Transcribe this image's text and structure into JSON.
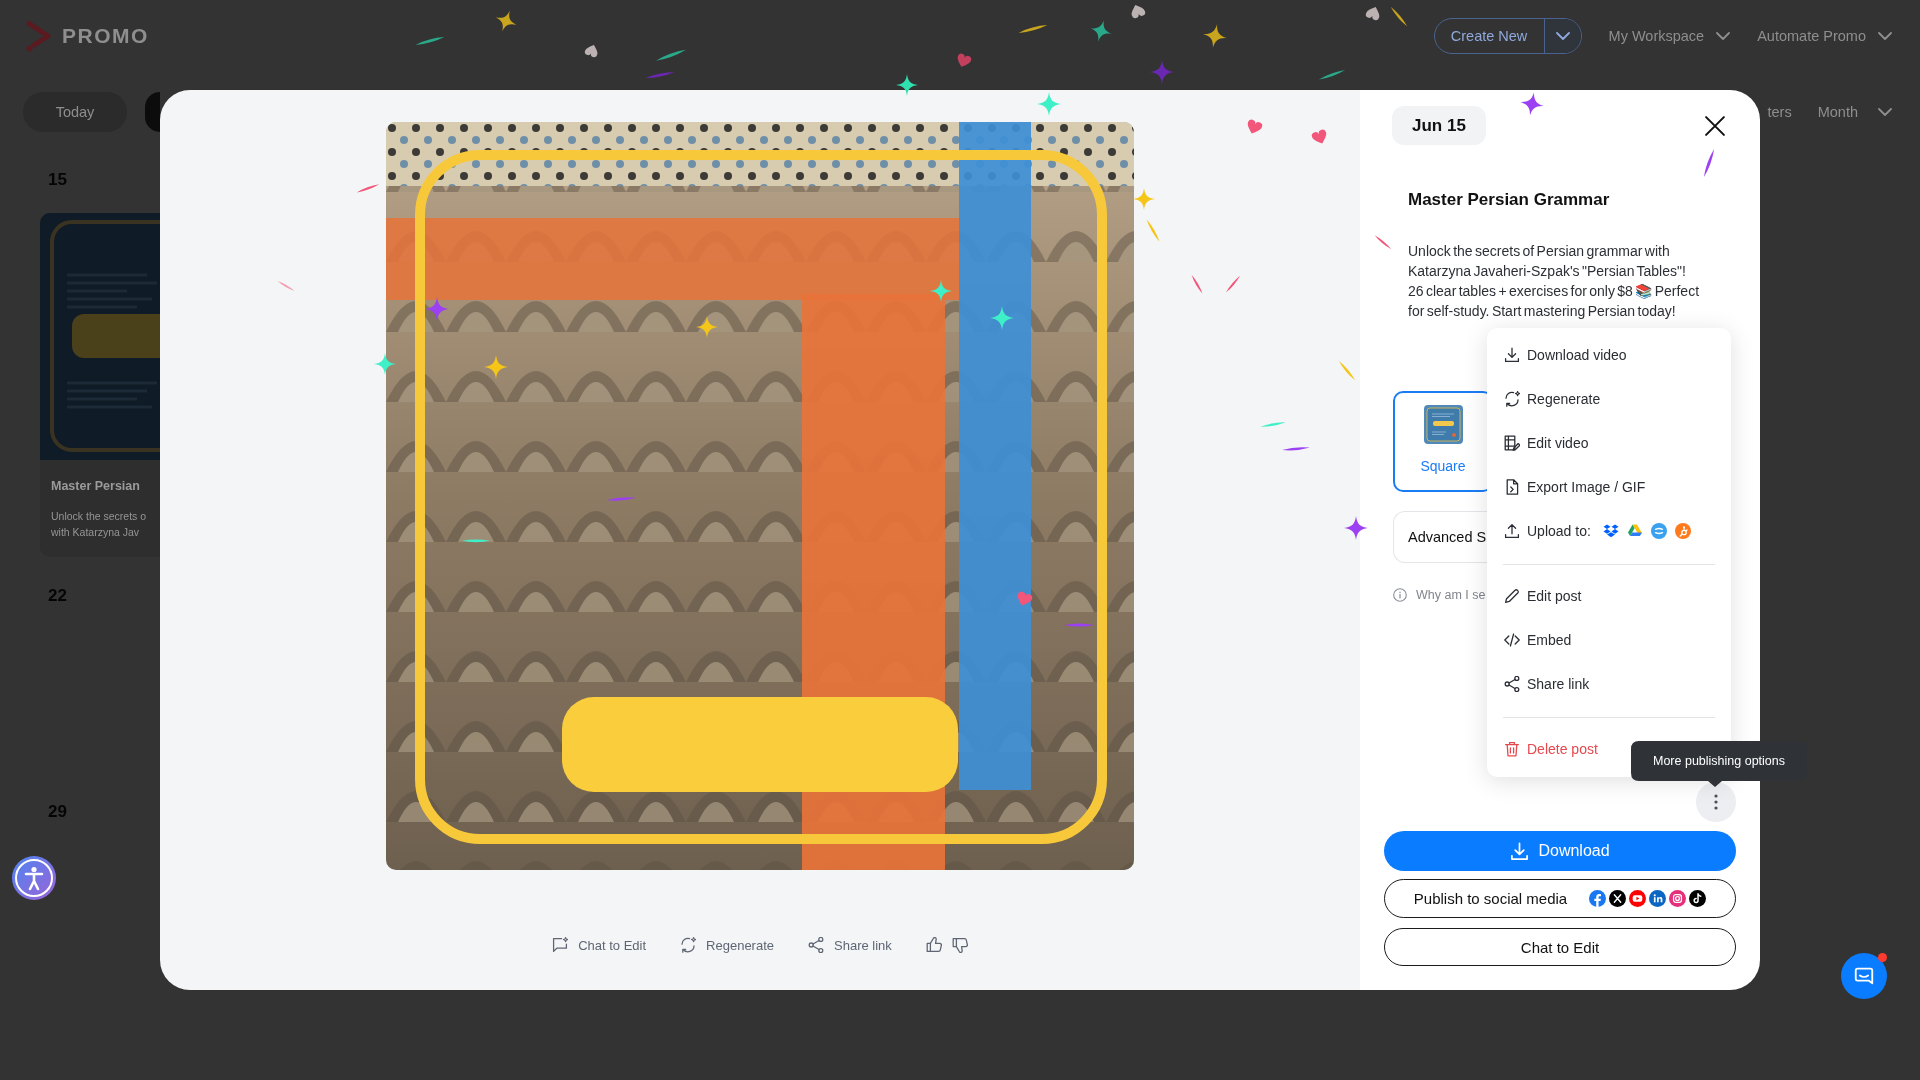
{
  "app_header": {
    "logo": "PROMO",
    "create_button": "Create New",
    "menus": [
      {
        "label": "My Workspace"
      },
      {
        "label": "Automate Promo"
      }
    ]
  },
  "calendar_toolbar": {
    "today_button": "Today",
    "filter_button": "ters",
    "view_menu": "Month"
  },
  "calendar": {
    "weeks": [
      {
        "day": "15",
        "posts": [
          {
            "title": "Master Persian",
            "excerpt_lines": [
              "Unlock the secrets o",
              "with Katarzyna Jav"
            ]
          }
        ]
      },
      {
        "day": "22"
      },
      {
        "day": "29"
      }
    ]
  },
  "post_modal": {
    "preview_actions": [
      {
        "kind": "chat",
        "label": "Chat to Edit"
      },
      {
        "kind": "regenerate",
        "label": "Regenerate"
      },
      {
        "kind": "share",
        "label": "Share link"
      },
      {
        "kind": "like"
      },
      {
        "kind": "dislike"
      }
    ],
    "date_badge": "Jun 15",
    "title": "Master Persian Grammar",
    "description": "Unlock the secrets of Persian grammar with Katarzyna Javaheri-Szpak's \"Persian Tables\"! 26 clear tables + exercises for only $8 📚 Perfect for self-study. Start mastering Persian today!",
    "formats": [
      {
        "label": "Square",
        "selected": true
      }
    ],
    "advanced_settings": "Advanced S",
    "info_link": "Why am I se",
    "more_menu": {
      "open": true,
      "sections": [
        {
          "items": [
            {
              "kind": "download",
              "label": "Download video"
            },
            {
              "kind": "regenerate",
              "label": "Regenerate"
            },
            {
              "kind": "edit_video",
              "label": "Edit video"
            },
            {
              "kind": "export",
              "label": "Export Image / GIF"
            },
            {
              "kind": "upload",
              "label": "Upload to:",
              "targets": [
                {
                  "kind": "dropbox"
                },
                {
                  "kind": "google_drive"
                },
                {
                  "kind": "chat_bubble"
                },
                {
                  "kind": "sprocket"
                }
              ]
            }
          ]
        },
        {
          "items": [
            {
              "kind": "edit_post",
              "label": "Edit post"
            },
            {
              "kind": "embed",
              "label": "Embed"
            },
            {
              "kind": "share",
              "label": "Share link"
            }
          ]
        },
        {
          "items": [
            {
              "kind": "delete",
              "label": "Delete post"
            }
          ]
        }
      ]
    },
    "tooltip": "More publishing options",
    "download_button": "Download",
    "publish_button": {
      "label": "Publish to social media",
      "networks": [
        {
          "kind": "facebook"
        },
        {
          "kind": "x"
        },
        {
          "kind": "youtube"
        },
        {
          "kind": "linkedin"
        },
        {
          "kind": "instagram"
        },
        {
          "kind": "tiktok"
        }
      ]
    },
    "chat_button": "Chat to Edit"
  },
  "chat_launcher": {
    "unread": true
  },
  "confetti": true
}
